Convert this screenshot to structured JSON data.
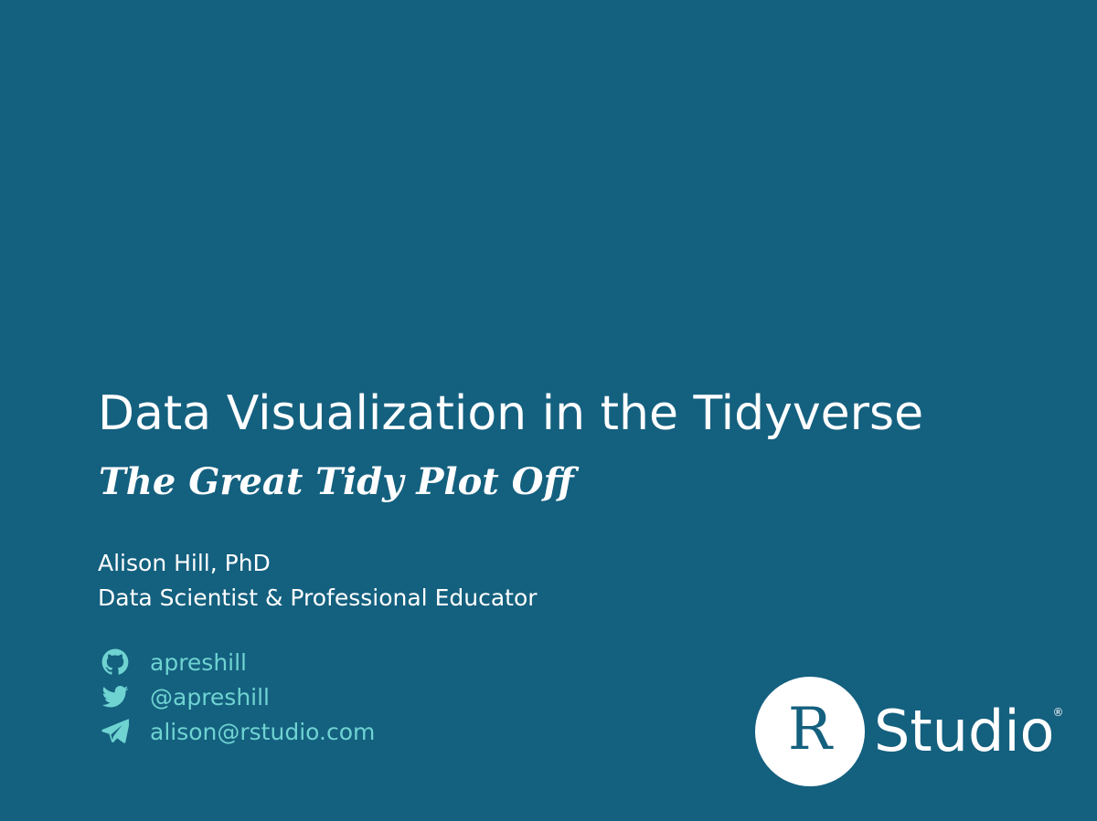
{
  "slide": {
    "title": "Data Visualization in the Tidyverse",
    "subtitle": "The Great Tidy Plot Off",
    "author": {
      "name": "Alison Hill, PhD",
      "role": "Data Scientist & Professional Educator"
    },
    "contacts": [
      {
        "icon": "github-icon",
        "text": "apreshill"
      },
      {
        "icon": "twitter-icon",
        "text": "@apreshill"
      },
      {
        "icon": "paper-plane-icon",
        "text": "alison@rstudio.com"
      }
    ],
    "logo": {
      "letter": "R",
      "word": "Studio",
      "registered": "®"
    }
  },
  "colors": {
    "background": "#14607f",
    "text": "#ffffff",
    "accent": "#6fd3d1"
  }
}
